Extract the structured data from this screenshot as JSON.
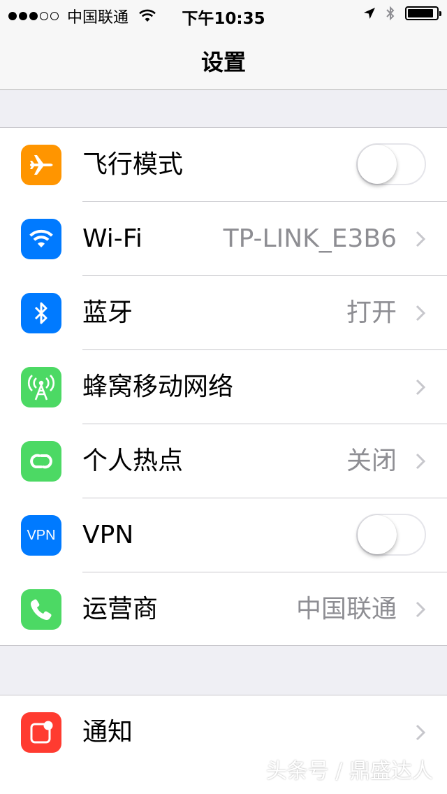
{
  "status_bar": {
    "signal_dots_on": 3,
    "signal_dots_total": 5,
    "carrier": "中国联通",
    "time": "下午10:35",
    "battery_level": 0.9
  },
  "nav": {
    "title": "设置"
  },
  "groups": [
    {
      "rows": [
        {
          "label": "飞行模式",
          "icon": "airplane-icon",
          "icon_color": "#ff9500",
          "control": "toggle",
          "toggle_on": false
        },
        {
          "label": "Wi-Fi",
          "icon": "wifi-icon",
          "icon_color": "#007aff",
          "value": "TP-LINK_E3B6",
          "control": "chevron"
        },
        {
          "label": "蓝牙",
          "icon": "bluetooth-icon",
          "icon_color": "#007aff",
          "value": "打开",
          "control": "chevron"
        },
        {
          "label": "蜂窝移动网络",
          "icon": "cellular-icon",
          "icon_color": "#4cd964",
          "control": "chevron"
        },
        {
          "label": "个人热点",
          "icon": "hotspot-icon",
          "icon_color": "#4cd964",
          "value": "关闭",
          "control": "chevron"
        },
        {
          "label": "VPN",
          "icon": "vpn-icon",
          "icon_text": "VPN",
          "icon_color": "#007aff",
          "control": "toggle",
          "toggle_on": false
        },
        {
          "label": "运营商",
          "icon": "phone-icon",
          "icon_color": "#4cd964",
          "value": "中国联通",
          "control": "chevron"
        }
      ]
    },
    {
      "rows": [
        {
          "label": "通知",
          "icon": "notifications-icon",
          "icon_color": "#ff3b30",
          "control": "chevron"
        }
      ]
    }
  ],
  "watermark": "头条号 / 鼎盛达人"
}
